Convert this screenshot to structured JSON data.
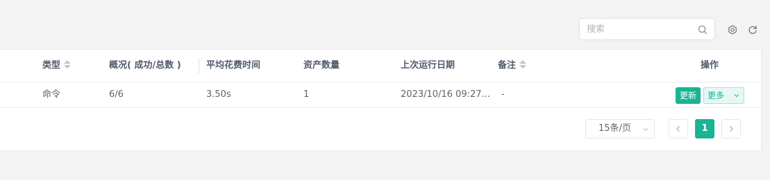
{
  "search": {
    "placeholder": "搜索",
    "value": ""
  },
  "toolbar": {
    "settings_icon": "gear-icon",
    "refresh_icon": "refresh-icon"
  },
  "table": {
    "columns": [
      {
        "label": "类型",
        "sortable": true
      },
      {
        "label": "概况( 成功/总数 )",
        "sortable": false
      },
      {
        "label": "平均花费时间",
        "sortable": false
      },
      {
        "label": "资产数量",
        "sortable": false
      },
      {
        "label": "上次运行日期",
        "sortable": false
      },
      {
        "label": "备注",
        "sortable": true
      },
      {
        "label": "操作",
        "sortable": false
      }
    ],
    "rows": [
      {
        "type": "命令",
        "summary": "6/6",
        "avg_time": "3.50s",
        "asset_count": "1",
        "last_run": "2023/10/16 09:27...",
        "comment": "-",
        "actions": {
          "update": "更新",
          "more": "更多"
        }
      }
    ]
  },
  "pagination": {
    "page_size": "15条/页",
    "current_page": "1"
  },
  "colors": {
    "accent": "#1ab394",
    "accent_light_bg": "#e8f7f4",
    "background": "#f3f3f3"
  }
}
